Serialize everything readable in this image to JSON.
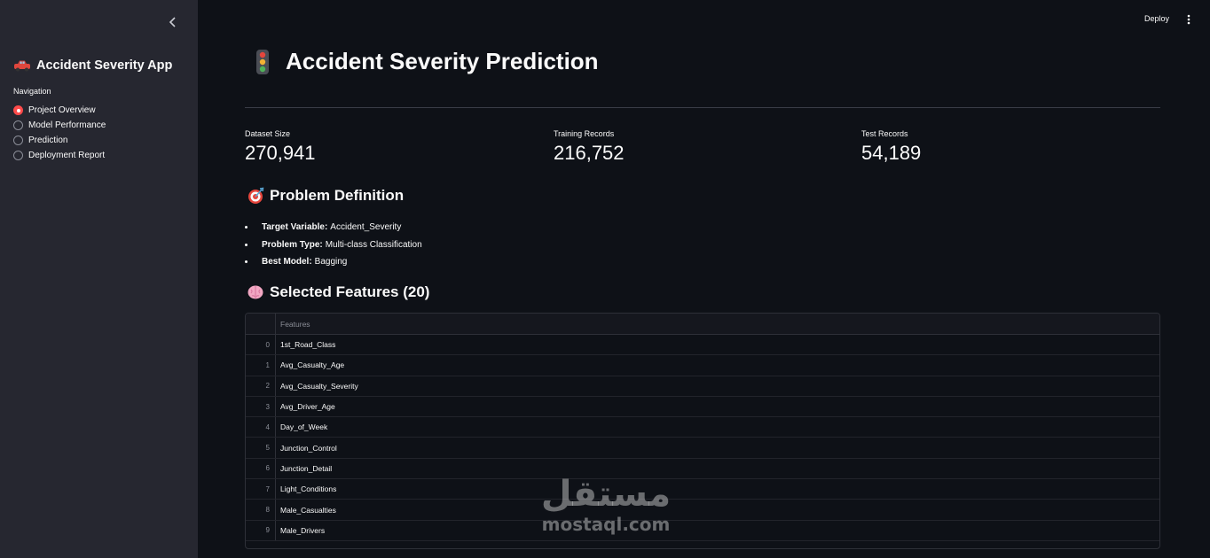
{
  "sidebar": {
    "app_title": "Accident Severity App",
    "title_icon": "car-icon",
    "nav_label": "Navigation",
    "nav_items": [
      {
        "label": "Project Overview",
        "selected": true
      },
      {
        "label": "Model Performance",
        "selected": false
      },
      {
        "label": "Prediction",
        "selected": false
      },
      {
        "label": "Deployment Report",
        "selected": false
      }
    ]
  },
  "topbar": {
    "deploy_label": "Deploy",
    "menu_icon": "kebab-menu-icon"
  },
  "main": {
    "title": "Accident Severity Prediction",
    "title_icon": "traffic-light-icon",
    "metrics": [
      {
        "label": "Dataset Size",
        "value": "270,941"
      },
      {
        "label": "Training Records",
        "value": "216,752"
      },
      {
        "label": "Test Records",
        "value": "54,189"
      }
    ],
    "problem": {
      "heading": "Problem Definition",
      "icon": "target-icon",
      "bullets": [
        {
          "key": "Target Variable:",
          "value": "Accident_Severity"
        },
        {
          "key": "Problem Type:",
          "value": "Multi-class Classification"
        },
        {
          "key": "Best Model:",
          "value": "Bagging"
        }
      ]
    },
    "features": {
      "heading": "Selected Features (20)",
      "icon": "brain-icon",
      "column": "Features",
      "rows": [
        {
          "index": "0",
          "value": "1st_Road_Class"
        },
        {
          "index": "1",
          "value": "Avg_Casualty_Age"
        },
        {
          "index": "2",
          "value": "Avg_Casualty_Severity"
        },
        {
          "index": "3",
          "value": "Avg_Driver_Age"
        },
        {
          "index": "4",
          "value": "Day_of_Week"
        },
        {
          "index": "5",
          "value": "Junction_Control"
        },
        {
          "index": "6",
          "value": "Junction_Detail"
        },
        {
          "index": "7",
          "value": "Light_Conditions"
        },
        {
          "index": "8",
          "value": "Male_Casualties"
        },
        {
          "index": "9",
          "value": "Male_Drivers"
        }
      ]
    }
  },
  "watermark": {
    "arabic": "مستقل",
    "latin": "mostaql.com"
  },
  "colors": {
    "accent": "#ff4b4b",
    "background": "#0e1117",
    "sidebar": "#262730"
  }
}
